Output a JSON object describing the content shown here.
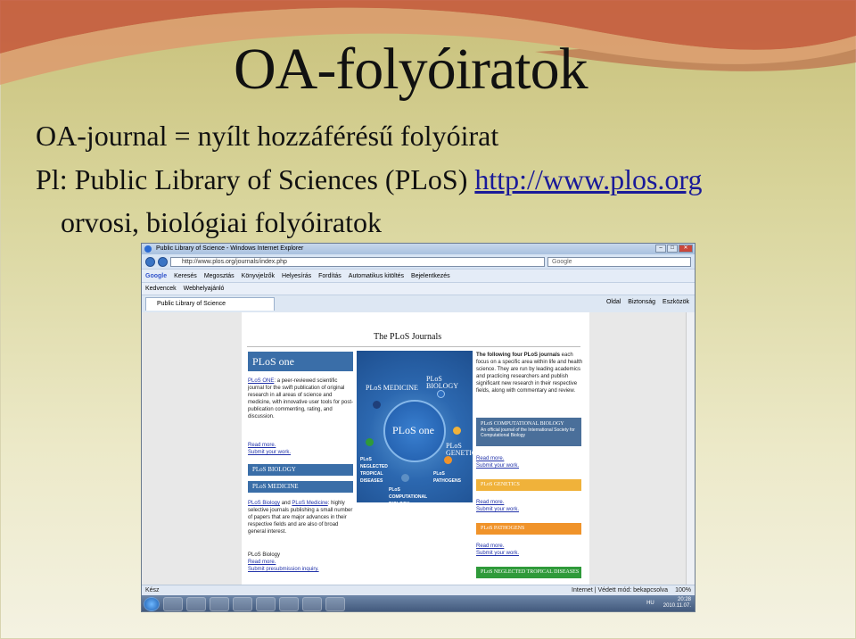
{
  "slide": {
    "title": "OA-folyóiratok",
    "line1": "OA-journal = nyílt hozzáférésű folyóirat",
    "line2_prefix": "Pl: Public Library of Sciences (PLoS)",
    "line2_link": "http://www.plos.org",
    "line3": "orvosi, biológiai folyóiratok"
  },
  "browser": {
    "window_title": "Public Library of Science - Windows Internet Explorer",
    "address": "http://www.plos.org/journals/index.php",
    "search_engine": "Google",
    "google_label": "Google",
    "google_items": [
      "Keresés",
      "Megosztás",
      "Könyvjelzők",
      "Helyesírás",
      "Fordítás",
      "Automatikus kitöltés",
      "Bejelentkezés"
    ],
    "favorites": [
      "Kedvencek",
      "Webhelyajánló"
    ],
    "tab_label": "Public Library of Science",
    "tab_tools": [
      "Oldal",
      "Biztonság",
      "Eszközök"
    ],
    "status_left": "Kész",
    "status_zone": "Internet | Védett mód: bekapcsolva",
    "zoom": "100%",
    "tray_lang": "HU",
    "clock_time": "20:28",
    "clock_date": "2010.11.07."
  },
  "plos": {
    "header": "The PLoS Journals",
    "one_banner": "PLoS one",
    "one_text_link": "PLoS ONE",
    "one_text": ": a peer-reviewed scientific journal for the swift publication of original research in all areas of science and medicine, with innovative user tools for post-publication commenting, rating, and discussion.",
    "read_more": "Read more.",
    "submit": "Submit your work.",
    "biology_banner": "PLoS BIOLOGY",
    "medicine_banner": "PLoS MEDICINE",
    "bio_med_link1": "PLoS Biology",
    "bio_med_and": "and",
    "bio_med_link2": "PLoS Medicine",
    "bio_med_text": ": highly selective journals publishing a small number of papers that are major advances in their respective fields and are also of broad general interest.",
    "plos_biology_label": "PLoS Biology",
    "presubmission": "Submit presubmission inquiry.",
    "hero": {
      "medicine": "PLoS MEDICINE",
      "biology": "PLoS BIOLOGY",
      "one": "PLoS one",
      "genetics": "PLoS GENETICS",
      "ntd": "PLoS NEGLECTED TROPICAL DISEASES",
      "pathogens": "PLoS PATHOGENS",
      "compbio": "PLoS COMPUTATIONAL BIOLOGY"
    },
    "right_intro_bold": "The following four PLoS journals",
    "right_intro": " each focus on a specific area within life and health science. They are run by leading academics and practicing researchers and publish significant new research in their respective fields, along with commentary and review.",
    "compbio_banner": "PLoS COMPUTATIONAL BIOLOGY",
    "compbio_sub": "An official journal of the International Society for Computational Biology",
    "genetics_banner": "PLoS GENETICS",
    "pathogens_banner": "PLoS PATHOGENS",
    "ntd_banner": "PLoS NEGLECTED TROPICAL DISEASES"
  },
  "colors": {
    "plos_blue": "#3a6ea8",
    "orange": "#f0932a",
    "green": "#2f9a3a",
    "link_blue": "#1a1a99"
  }
}
